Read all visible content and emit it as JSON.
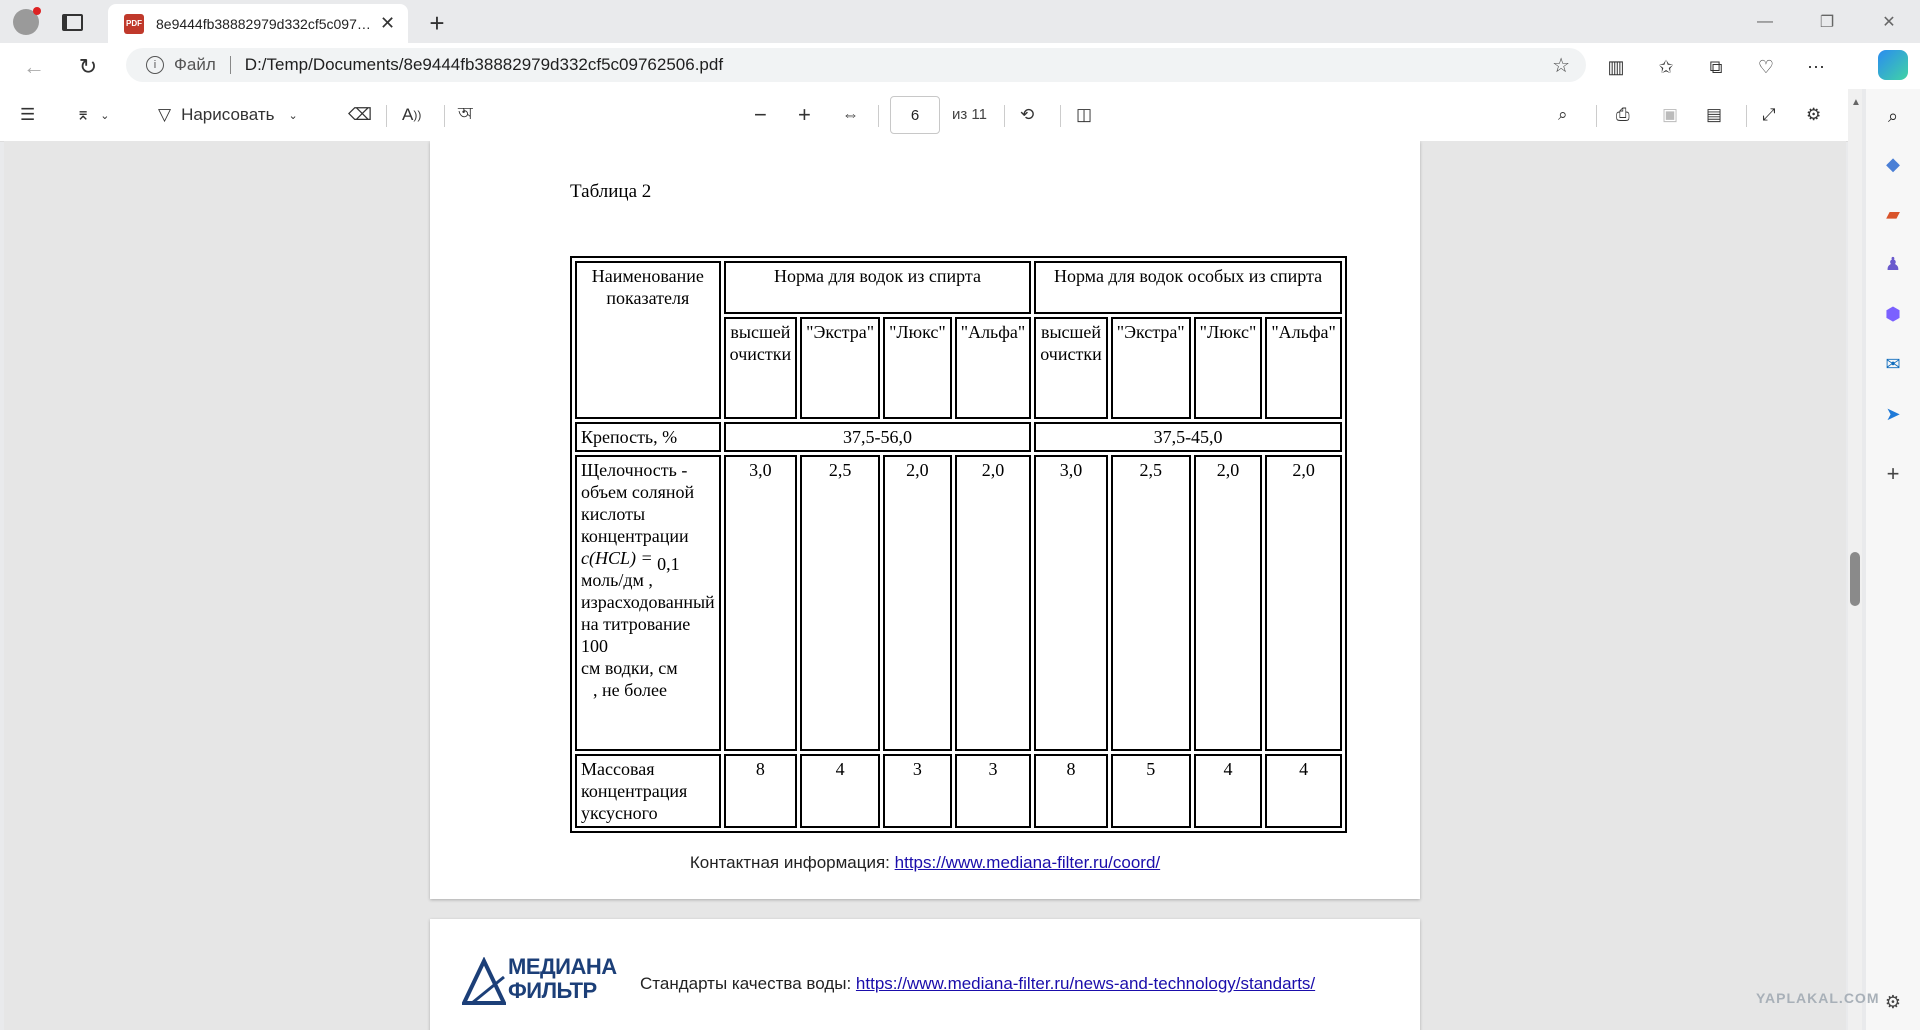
{
  "browser": {
    "tab_title": "8e9444fb38882979d332cf5c097…",
    "tab_icon": "PDF",
    "scheme": "Файл",
    "url": "D:/Temp/Documents/8e9444fb38882979d332cf5c09762506.pdf"
  },
  "toolbar": {
    "draw_label": "Нарисовать",
    "page_number": "6",
    "page_of": "из 11"
  },
  "document": {
    "caption": "Таблица 2",
    "header": {
      "name": "Наименование показателя",
      "group1": "Норма для водок из спирта",
      "group2": "Норма для водок особых из спирта",
      "sub": [
        "высшей очистки",
        "\"Экстра\"",
        "\"Люкс\"",
        "\"Альфа\"",
        "высшей очистки",
        "\"Экстра\"",
        "\"Люкс\"",
        "\"Альфа\""
      ]
    },
    "row_strength": {
      "label": "Крепость, %",
      "v1": "37,5-56,0",
      "v2": "37,5-45,0"
    },
    "row_alkalinity": {
      "label": "Щелочность - объем соляной кислоты концентрации",
      "formula": "c(HCL) =",
      "formula_value": "0,1",
      "label_rest": "моль/дм   , израсходованный на титрование 100",
      "label_end": "см    водки, см",
      "label_tail": ", не более",
      "values": [
        "3,0",
        "2,5",
        "2,0",
        "2,0",
        "3,0",
        "2,5",
        "2,0",
        "2,0"
      ]
    },
    "row_acetic": {
      "label": "Массовая концентрация уксусного",
      "values": [
        "8",
        "4",
        "3",
        "3",
        "8",
        "5",
        "4",
        "4"
      ]
    },
    "contact_label": "Контактная информация: ",
    "contact_link": "https://www.mediana-filter.ru/coord/",
    "logo_line1": "МЕДИАНА",
    "logo_line2": "ФИЛЬТР",
    "standards_label": "Стандарты качества воды: ",
    "standards_link": "https://www.mediana-filter.ru/news-and-technology/standarts/"
  },
  "watermark": "YAPLAKAL.COM"
}
